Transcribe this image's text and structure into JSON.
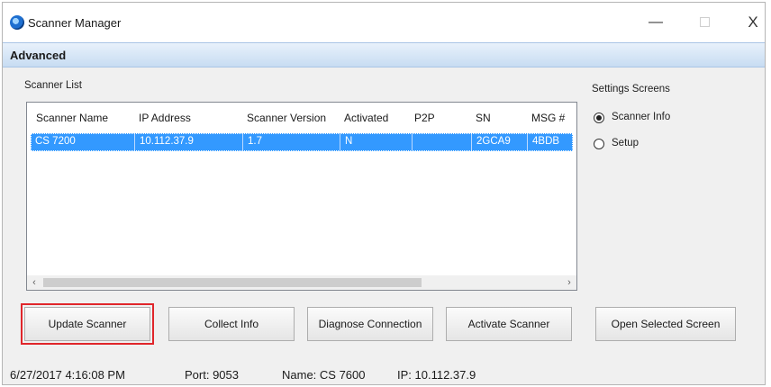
{
  "window": {
    "title": "Scanner Manager",
    "icons": {
      "app": "scanner-manager-logo",
      "minimize": "minimize-icon",
      "maximize": "maximize-icon",
      "close": "close-icon"
    },
    "close_glyph": "X",
    "minimize_glyph": "—"
  },
  "header": {
    "title": "Advanced"
  },
  "scanner_list": {
    "label": "Scanner List",
    "columns": [
      "Scanner Name",
      "IP Address",
      "Scanner Version",
      "Activated",
      "P2P",
      "SN",
      "MSG #"
    ],
    "rows": [
      [
        "CS 7200",
        "10.112.37.9",
        "1.7",
        "N",
        "",
        "2GCA9",
        "4BDB"
      ]
    ],
    "selected_row_color": "#3399ff"
  },
  "settings": {
    "label": "Settings Screens",
    "options": [
      {
        "label": "Scanner Info",
        "selected": true
      },
      {
        "label": "Setup",
        "selected": false
      }
    ]
  },
  "buttons": {
    "update": "Update Scanner",
    "collect": "Collect Info",
    "diagnose": "Diagnose Connection",
    "activate": "Activate Scanner",
    "open_selected": "Open Selected Screen",
    "highlight_color": "#e0262b"
  },
  "status": {
    "timestamp": "6/27/2017 4:16:08 PM",
    "port": "Port: 9053",
    "name": "Name: CS 7600",
    "ip": "IP: 10.112.37.9"
  }
}
